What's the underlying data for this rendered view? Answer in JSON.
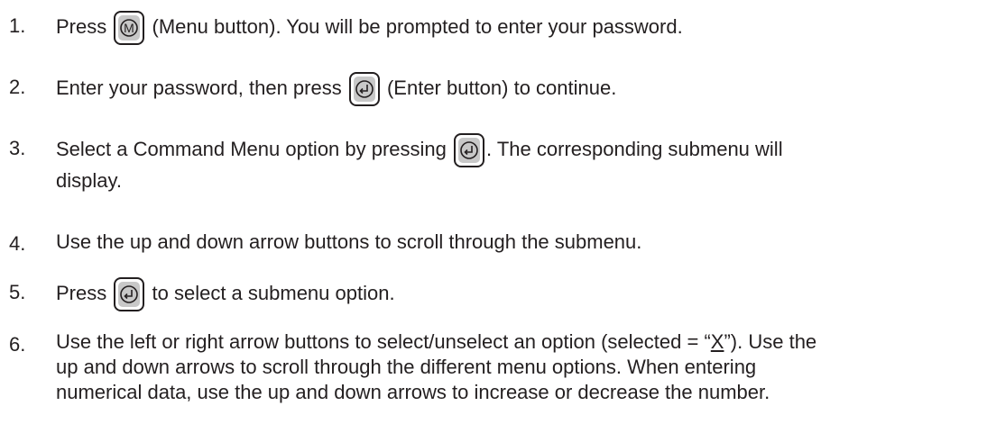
{
  "steps": [
    {
      "num": "1.",
      "before": "Press",
      "button_icon": "menu-button-icon",
      "after": "(Menu button). You will be prompted to enter your password."
    },
    {
      "num": "2.",
      "before": "Enter your password, then press",
      "button_icon": "enter-button-icon",
      "after": "(Enter button) to continue."
    },
    {
      "num": "3.",
      "before": "Select a Command Menu option by pressing",
      "button_icon": "enter-button-icon",
      "after": ". The corresponding submenu will",
      "line2": "display."
    },
    {
      "num": "4.",
      "text": "Use the up and down arrow buttons to scroll through the submenu."
    },
    {
      "num": "5.",
      "before": "Press",
      "button_icon": "enter-button-icon",
      "after": "to select a submenu option."
    },
    {
      "num": "6.",
      "text_a": "Use the left or right arrow buttons to select/unselect an option (selected = “",
      "text_x": "X",
      "text_b": "”). Use the",
      "line2": "up and down arrows to scroll through the different menu options. When entering",
      "line3": "numerical data, use the up and down arrows to increase or decrease the number."
    }
  ],
  "menu_key_letter": "M"
}
